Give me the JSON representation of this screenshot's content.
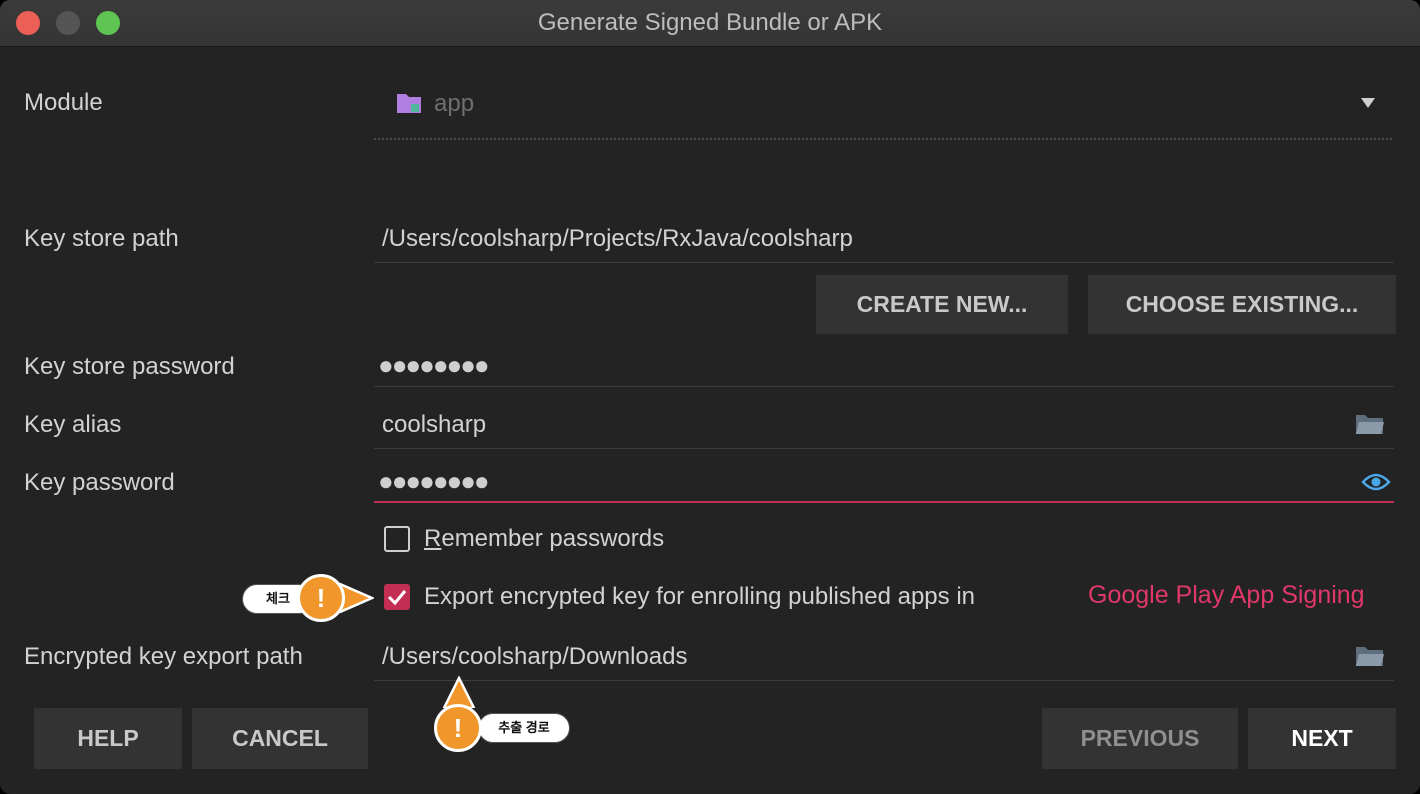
{
  "window": {
    "title": "Generate Signed Bundle or APK"
  },
  "module": {
    "label": "Module",
    "value": "app"
  },
  "key_store_path": {
    "label": "Key store path",
    "value": "/Users/coolsharp/Projects/RxJava/coolsharp"
  },
  "buttons": {
    "create_new": "CREATE NEW...",
    "choose_existing": "CHOOSE EXISTING...",
    "help": "HELP",
    "cancel": "CANCEL",
    "previous": "PREVIOUS",
    "next": "NEXT"
  },
  "key_store_password": {
    "label": "Key store password",
    "value": "●●●●●●●●"
  },
  "key_alias": {
    "label": "Key alias",
    "value": "coolsharp"
  },
  "key_password": {
    "label": "Key password",
    "value": "●●●●●●●●"
  },
  "remember_passwords": {
    "prefix": "R",
    "label": "emember passwords",
    "checked": false
  },
  "export_encrypted": {
    "label": "Export encrypted key for enrolling published apps in",
    "link": "Google Play App Signing",
    "checked": true
  },
  "encrypted_key_export_path": {
    "label": "Encrypted key export path",
    "value": "/Users/coolsharp/Downloads"
  },
  "annotations": {
    "check_label": "체크",
    "path_label": "추출 경로",
    "mark": "!"
  },
  "colors": {
    "accent": "#c32f54",
    "link": "#e0386a",
    "callout": "#f0962b"
  }
}
